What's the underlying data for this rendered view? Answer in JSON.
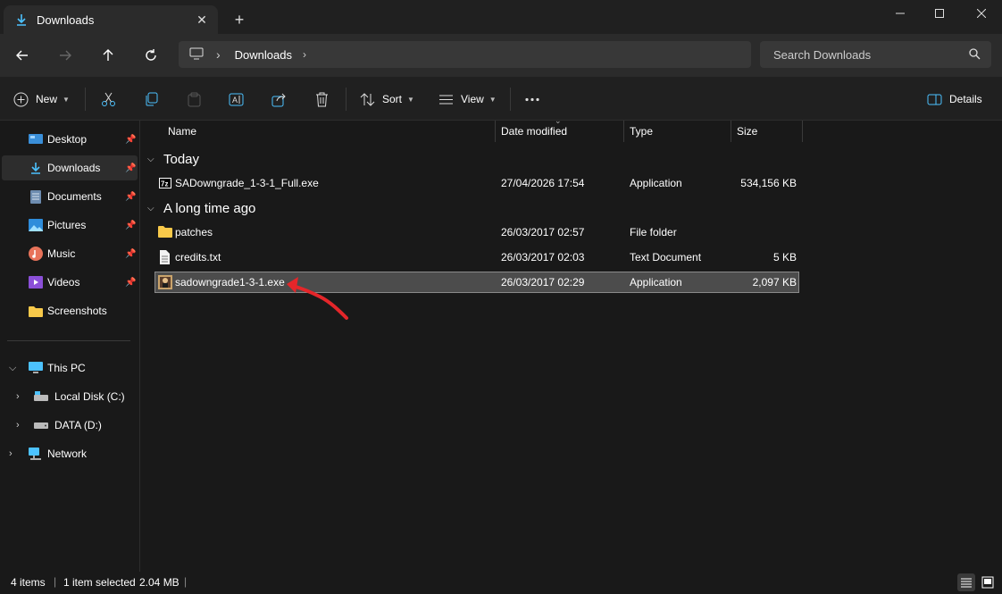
{
  "window": {
    "tab_title": "Downloads"
  },
  "address": {
    "crumb": "Downloads",
    "search_placeholder": "Search Downloads"
  },
  "toolbar": {
    "new_label": "New",
    "sort_label": "Sort",
    "view_label": "View",
    "details_label": "Details"
  },
  "sidebar": {
    "quick_access": [
      {
        "label": "Desktop",
        "icon": "desktop-icon"
      },
      {
        "label": "Downloads",
        "icon": "download-icon"
      },
      {
        "label": "Documents",
        "icon": "documents-icon"
      },
      {
        "label": "Pictures",
        "icon": "pictures-icon"
      },
      {
        "label": "Music",
        "icon": "music-icon"
      },
      {
        "label": "Videos",
        "icon": "videos-icon"
      },
      {
        "label": "Screenshots",
        "icon": "folder-icon"
      }
    ],
    "this_pc": "This PC",
    "drives": [
      "Local Disk (C:)",
      "DATA (D:)"
    ],
    "network": "Network"
  },
  "columns": {
    "name": "Name",
    "date": "Date modified",
    "type": "Type",
    "size": "Size"
  },
  "groups": [
    {
      "title": "Today",
      "files": [
        {
          "name": "SADowngrade_1-3-1_Full.exe",
          "date": "27/04/2026 17:54",
          "type": "Application",
          "size": "534,156 KB",
          "icon": "7z-icon"
        }
      ]
    },
    {
      "title": "A long time ago",
      "files": [
        {
          "name": "patches",
          "date": "26/03/2017 02:57",
          "type": "File folder",
          "size": "",
          "icon": "folder-icon"
        },
        {
          "name": "credits.txt",
          "date": "26/03/2017 02:03",
          "type": "Text Document",
          "size": "5 KB",
          "icon": "text-file-icon"
        },
        {
          "name": "sadowngrade1-3-1.exe",
          "date": "26/03/2017 02:29",
          "type": "Application",
          "size": "2,097 KB",
          "icon": "app-icon"
        }
      ]
    }
  ],
  "status": {
    "items": "4 items",
    "selected": "1 item selected",
    "size": "2.04 MB"
  },
  "colors": {
    "accent": "#4cc2ff",
    "folder": "#f8c94a",
    "annotation": "#e4262a",
    "selection": "#4c4c4c"
  }
}
